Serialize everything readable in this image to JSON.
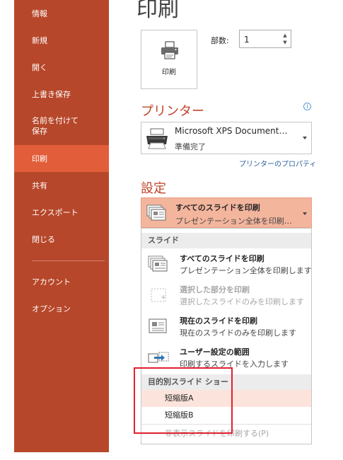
{
  "sidebar": {
    "items": [
      {
        "label": "情報",
        "active": false
      },
      {
        "label": "新規",
        "active": false
      },
      {
        "label": "開く",
        "active": false
      },
      {
        "label": "上書き保存",
        "active": false
      },
      {
        "label": "名前を付けて\n保存",
        "active": false
      },
      {
        "label": "印刷",
        "active": true
      },
      {
        "label": "共有",
        "active": false
      },
      {
        "label": "エクスポート",
        "active": false
      },
      {
        "label": "閉じる",
        "active": false
      },
      {
        "label": "アカウント",
        "active": false
      },
      {
        "label": "オプション",
        "active": false
      }
    ]
  },
  "page_title": "印刷",
  "print_button": {
    "label": "印刷",
    "icon": "printer-icon"
  },
  "copies": {
    "label": "部数:",
    "value": "1"
  },
  "printer": {
    "heading": "プリンター",
    "name": "Microsoft XPS Document…",
    "status": "準備完了",
    "properties_link": "プリンターのプロパティ"
  },
  "settings": {
    "heading": "設定",
    "selected_title": "すべてのスライドを印刷",
    "selected_desc": "プレゼンテーション全体を印刷…"
  },
  "menu": {
    "slides_header": "スライド",
    "options": [
      {
        "title": "すべてのスライドを印刷",
        "desc": "プレゼンテーション全体を印刷します",
        "disabled": false
      },
      {
        "title": "選択した部分を印刷",
        "desc": "選択したスライドのみを印刷します",
        "disabled": true
      },
      {
        "title": "現在のスライドを印刷",
        "desc": "現在のスライドのみを印刷します",
        "disabled": false
      },
      {
        "title": "ユーザー設定の範囲",
        "desc": "印刷するスライドを入力します",
        "disabled": false
      }
    ],
    "custom_show_header": "目的別スライド ショー",
    "custom_shows": [
      "短縮版A",
      "短縮版B"
    ],
    "print_hidden": "非表示スライドを印刷する(P)"
  },
  "colors": {
    "sidebar": "#b7472a",
    "sidebar_active": "#e25d3a",
    "accent_heading": "#c1442a",
    "highlight": "#e0202e"
  }
}
